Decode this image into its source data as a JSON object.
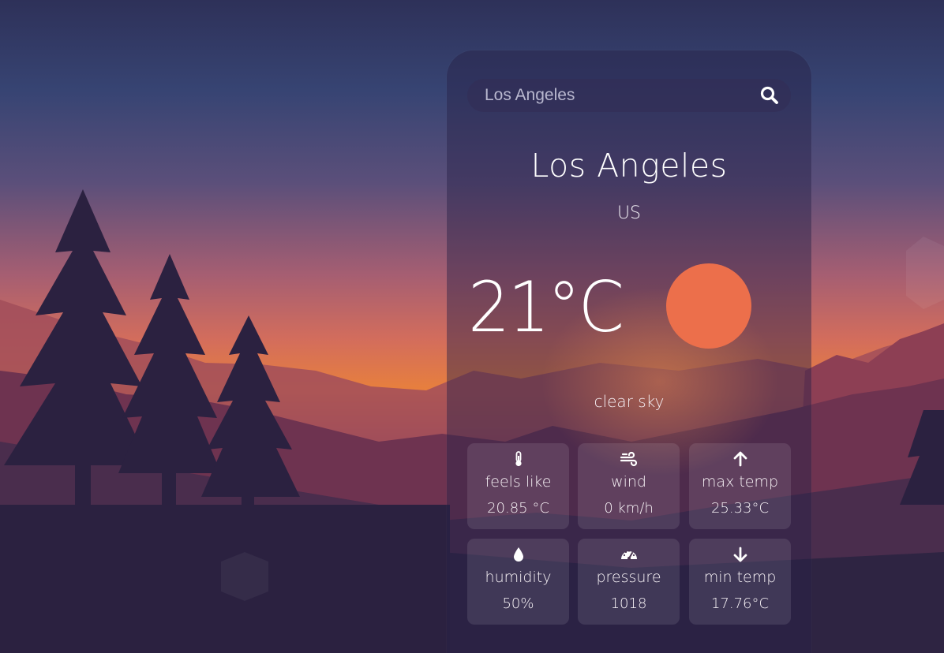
{
  "search": {
    "value": "Los Angeles",
    "placeholder": "Los Angeles",
    "icon": "search-icon"
  },
  "weather": {
    "city": "Los Angeles",
    "country": "US",
    "temperature": "21°C",
    "condition": "clear sky",
    "condition_icon": "sun-icon"
  },
  "stats": [
    {
      "icon": "thermometer-icon",
      "label": "feels like",
      "value": "20.85 °C"
    },
    {
      "icon": "wind-icon",
      "label": "wind",
      "value": "0 km/h"
    },
    {
      "icon": "arrow-up-icon",
      "label": "max temp",
      "value": "25.33°C"
    },
    {
      "icon": "water-drop-icon",
      "label": "humidity",
      "value": "50%"
    },
    {
      "icon": "gauge-icon",
      "label": "pressure",
      "value": "1018"
    },
    {
      "icon": "arrow-down-icon",
      "label": "min temp",
      "value": "17.76°C"
    }
  ],
  "colors": {
    "sun": "#ec6f4b",
    "text": "#ffffff"
  }
}
